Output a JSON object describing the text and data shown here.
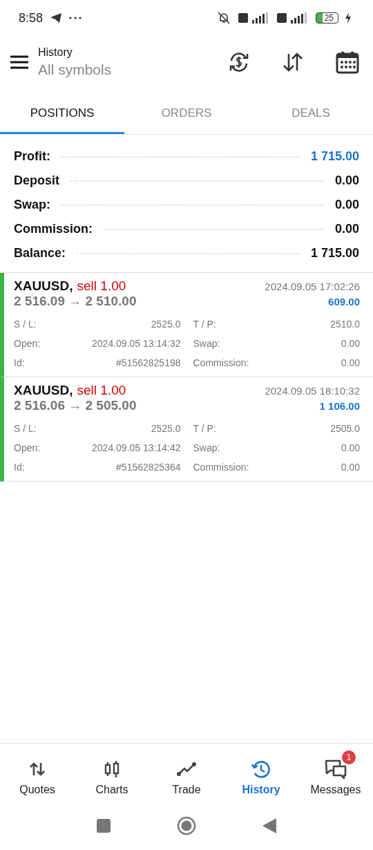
{
  "status_bar": {
    "time": "8:58",
    "battery": "25"
  },
  "header": {
    "title": "History",
    "subtitle": "All symbols"
  },
  "tabs": [
    {
      "label": "POSITIONS",
      "selected": true
    },
    {
      "label": "ORDERS",
      "selected": false
    },
    {
      "label": "DEALS",
      "selected": false
    }
  ],
  "summary": [
    {
      "label": "Profit:",
      "value": "1 715.00",
      "kind": "profit"
    },
    {
      "label": "Deposit",
      "value": "0.00",
      "kind": "plain"
    },
    {
      "label": "Swap:",
      "value": "0.00",
      "kind": "plain"
    },
    {
      "label": "Commission:",
      "value": "0.00",
      "kind": "plain"
    },
    {
      "label": "Balance:",
      "value": "1 715.00",
      "kind": "plain"
    }
  ],
  "positions": [
    {
      "symbol": "XAUUSD,",
      "side": "sell 1.00",
      "time": "2024.09.05 17:02:26",
      "prices": "2 516.09 → 2 510.00",
      "profit": "609.00",
      "fields": [
        {
          "label": "S / L:",
          "value": "2525.0"
        },
        {
          "label": "T / P:",
          "value": "2510.0"
        },
        {
          "label": "Open:",
          "value": "2024.09.05 13:14:32"
        },
        {
          "label": "Swap:",
          "value": "0.00"
        },
        {
          "label": "Id:",
          "value": "#51562825198"
        },
        {
          "label": "Commission:",
          "value": "0.00"
        }
      ]
    },
    {
      "symbol": "XAUUSD,",
      "side": "sell 1.00",
      "time": "2024.09.05 18:10:32",
      "prices": "2 516.06 → 2 505.00",
      "profit": "1 106.00",
      "fields": [
        {
          "label": "S / L:",
          "value": "2525.0"
        },
        {
          "label": "T / P:",
          "value": "2505.0"
        },
        {
          "label": "Open:",
          "value": "2024.09.05 13:14:42"
        },
        {
          "label": "Swap:",
          "value": "0.00"
        },
        {
          "label": "Id:",
          "value": "#51562825364"
        },
        {
          "label": "Commission:",
          "value": "0.00"
        }
      ]
    }
  ],
  "bottom_nav": [
    {
      "label": "Quotes",
      "selected": false
    },
    {
      "label": "Charts",
      "selected": false
    },
    {
      "label": "Trade",
      "selected": false
    },
    {
      "label": "History",
      "selected": true
    },
    {
      "label": "Messages",
      "selected": false,
      "badge": "1"
    }
  ]
}
